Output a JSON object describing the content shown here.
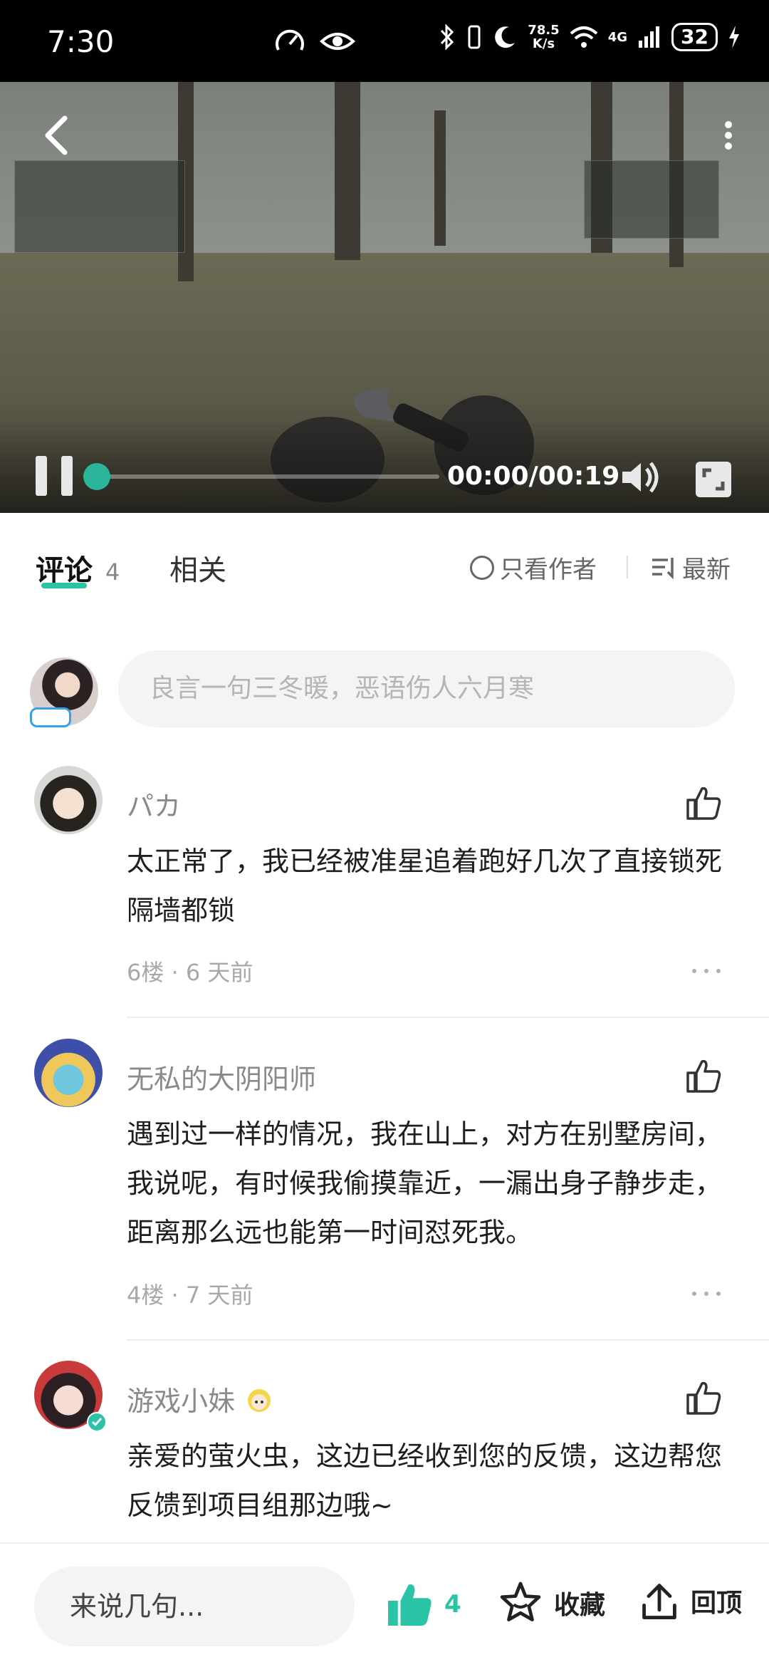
{
  "status_bar": {
    "time": "7:30",
    "net_speed_value": "78.5",
    "net_speed_unit": "K/s",
    "signal_label": "4G",
    "battery": "32"
  },
  "video": {
    "time": "00:00/00:19",
    "progress": 0.0
  },
  "tabs": {
    "comments_label": "评论",
    "comments_count": "4",
    "related_label": "相关",
    "only_author_label": "只看作者",
    "sort_label": "最新"
  },
  "composer": {
    "placeholder": "良言一句三冬暖，恶语伤人六月寒"
  },
  "comments": [
    {
      "name": "パカ",
      "body": "太正常了，我已经被准星追着跑好几次了直接锁死隔墙都锁",
      "floor": "6楼",
      "time": "6 天前"
    },
    {
      "name": "无私的大阴阳师",
      "body": "遇到过一样的情况，我在山上，对方在别墅房间，我说呢，有时候我偷摸靠近，一漏出身子静步走，距离那么远也能第一时间怼死我。",
      "floor": "4楼",
      "time": "7 天前"
    },
    {
      "name": "游戏小妹",
      "body": "亲爱的萤火虫，这边已经收到您的反馈，这边帮您反馈到项目组那边哦~",
      "floor": "",
      "time": ""
    }
  ],
  "bottom_bar": {
    "input_placeholder": "来说几句...",
    "like_count": "4",
    "favorite_label": "收藏",
    "back_top_label": "回顶"
  },
  "colors": {
    "accent": "#2bc3a6",
    "text_primary": "#1e1e1e",
    "text_secondary": "#8a8a8a"
  }
}
